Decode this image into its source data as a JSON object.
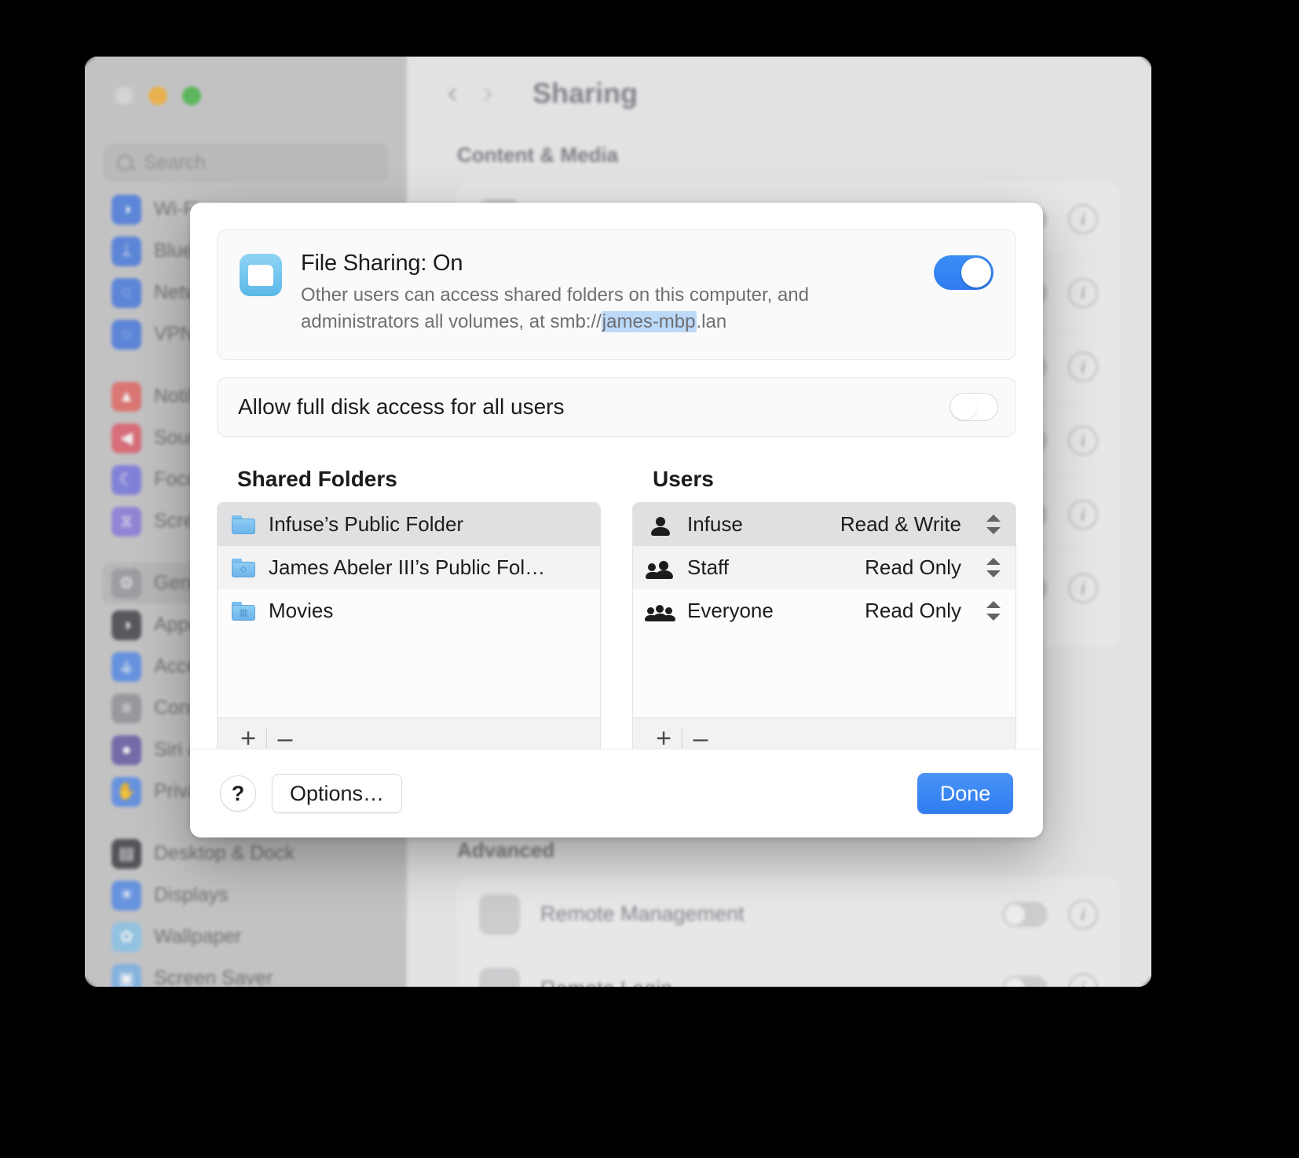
{
  "window": {
    "traffic_lights": [
      "close",
      "minimize",
      "zoom"
    ],
    "search": {
      "placeholder": "Search",
      "value": ""
    },
    "sidebar_groups": [
      {
        "items": [
          {
            "label": "Wi-Fi",
            "icon": "wifi-icon",
            "color": "#4f7fe0",
            "glyph": "◑",
            "selected": false
          },
          {
            "label": "Bluetooth",
            "icon": "bluetooth-icon",
            "color": "#4f7fe0",
            "glyph": "ᛦ",
            "selected": false
          },
          {
            "label": "Network",
            "icon": "globe-icon",
            "color": "#4f7fe0",
            "glyph": "◌",
            "selected": false
          },
          {
            "label": "VPN",
            "icon": "vpn-globe-icon",
            "color": "#4f7fe0",
            "glyph": "◌",
            "selected": false
          }
        ]
      },
      {
        "items": [
          {
            "label": "Notifications",
            "icon": "bell-icon",
            "color": "#e46d68",
            "glyph": "▲",
            "selected": false
          },
          {
            "label": "Sound",
            "icon": "speaker-icon",
            "color": "#e0636f",
            "glyph": "◀",
            "selected": false
          },
          {
            "label": "Focus",
            "icon": "moon-icon",
            "color": "#7b7ae0",
            "glyph": "☾",
            "selected": false
          },
          {
            "label": "Screen Time",
            "icon": "hourglass-icon",
            "color": "#8d7fdc",
            "glyph": "⧖",
            "selected": false
          }
        ]
      },
      {
        "items": [
          {
            "label": "General",
            "icon": "gear-icon",
            "color": "#9a9a9f",
            "glyph": "⚙",
            "selected": true
          },
          {
            "label": "Appearance",
            "icon": "contrast-icon",
            "color": "#4a4a4e",
            "glyph": "◑",
            "selected": false
          },
          {
            "label": "Accessibility",
            "icon": "accessibility-icon",
            "color": "#5b8fe8",
            "glyph": "⚶",
            "selected": false
          },
          {
            "label": "Control Center",
            "icon": "sliders-icon",
            "color": "#96969b",
            "glyph": "≡",
            "selected": false
          },
          {
            "label": "Siri & Spotlight",
            "icon": "siri-icon",
            "color": "#6d5fa8",
            "glyph": "●",
            "selected": false
          },
          {
            "label": "Privacy & Security",
            "icon": "hand-icon",
            "color": "#5b8fe8",
            "glyph": "✋",
            "selected": false
          }
        ]
      },
      {
        "items": [
          {
            "label": "Desktop & Dock",
            "icon": "desktop-dock-icon",
            "color": "#454549",
            "glyph": "▤",
            "selected": false
          },
          {
            "label": "Displays",
            "icon": "brightness-icon",
            "color": "#5b8fe8",
            "glyph": "☀",
            "selected": false
          },
          {
            "label": "Wallpaper",
            "icon": "wallpaper-icon",
            "color": "#8ec7ea",
            "glyph": "✿",
            "selected": false
          },
          {
            "label": "Screen Saver",
            "icon": "screensaver-icon",
            "color": "#7fb4e6",
            "glyph": "▣",
            "selected": false
          }
        ]
      }
    ]
  },
  "detail": {
    "nav": {
      "back": "‹",
      "forward": "›"
    },
    "title": "Sharing",
    "sections": [
      {
        "heading": "Content & Media"
      },
      {
        "heading": "Advanced"
      }
    ],
    "content_media_rows": [
      {
        "label": "",
        "icon": "file-sharing-icon"
      },
      {
        "label": "",
        "icon": "media-sharing-icon"
      },
      {
        "label": "",
        "icon": "printer-sharing-icon"
      },
      {
        "label": "",
        "icon": "internet-sharing-icon"
      },
      {
        "label": "",
        "icon": "content-caching-icon"
      },
      {
        "label": "",
        "icon": "bluetooth-sharing-icon"
      }
    ],
    "advanced_rows": [
      {
        "label": "Remote Management",
        "icon": "binoculars-icon"
      },
      {
        "label": "Remote Login",
        "icon": "remote-login-icon"
      }
    ]
  },
  "sheet": {
    "file_sharing": {
      "title": "File Sharing: On",
      "description_prefix": "Other users can access shared folders on this computer, and administrators all volumes, at smb://",
      "host": "james-mbp",
      "description_suffix": ".lan",
      "toggle_state": "on",
      "icon": "folder-app-icon"
    },
    "full_disk_access": {
      "label": "Allow full disk access for all users",
      "toggle_state": "off"
    },
    "shared_folders": {
      "title": "Shared Folders",
      "items": [
        {
          "name": "Infuse’s Public Folder",
          "icon": "folder-icon",
          "badge": "",
          "selected": true
        },
        {
          "name": "James Abeler III’s Public Fol…",
          "icon": "folder-public-icon",
          "badge": "◇",
          "selected": false
        },
        {
          "name": "Movies",
          "icon": "folder-movies-icon",
          "badge": "▥",
          "selected": false
        }
      ],
      "add_label": "+",
      "remove_label": "–"
    },
    "users": {
      "title": "Users",
      "items": [
        {
          "name": "Infuse",
          "permission": "Read & Write",
          "icon": "person-icon",
          "people": 1,
          "selected": true
        },
        {
          "name": "Staff",
          "permission": "Read Only",
          "icon": "two-people-icon",
          "people": 2,
          "selected": false
        },
        {
          "name": "Everyone",
          "permission": "Read Only",
          "icon": "three-people-icon",
          "people": 3,
          "selected": false
        }
      ],
      "add_label": "+",
      "remove_label": "–"
    },
    "footer": {
      "help_label": "?",
      "options_label": "Options…",
      "done_label": "Done"
    }
  },
  "colors": {
    "accent_blue": "#2f7cf0",
    "highlight_blue": "#bcd9f7",
    "selected_row": "#e0e0e2",
    "folder_blue": "#6bb4ea"
  }
}
